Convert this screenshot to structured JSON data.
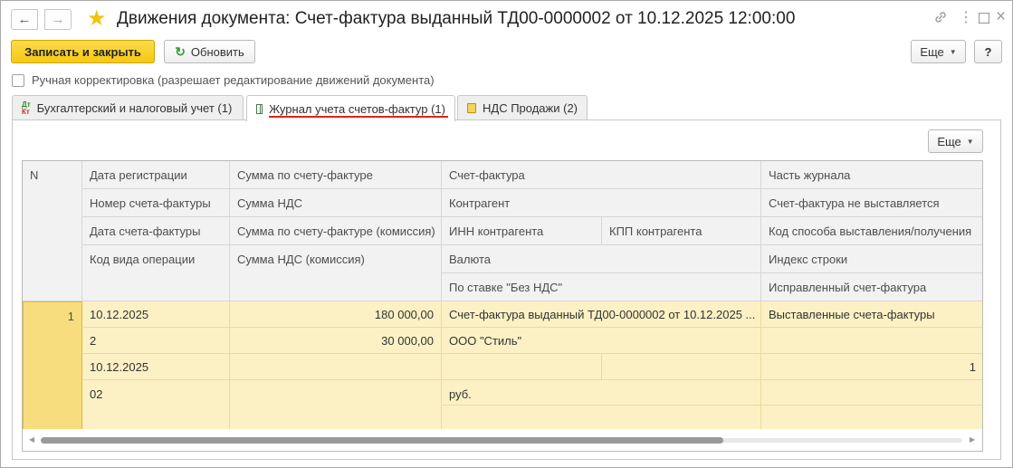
{
  "window": {
    "title": "Движения документа: Счет-фактура выданный ТД00-0000002 от 10.12.2025 12:00:00"
  },
  "toolbar": {
    "save_close_label": "Записать и закрыть",
    "refresh_label": "Обновить",
    "more_label": "Еще",
    "help_label": "?"
  },
  "manual_correction": {
    "label": "Ручная корректировка (разрешает редактирование движений документа)",
    "checked": false
  },
  "tabs": [
    {
      "label": "Бухгалтерский и налоговый учет (1)",
      "icon": "dt-kt-icon",
      "active": false
    },
    {
      "label": "Журнал учета счетов-фактур (1)",
      "icon": "table-grid-icon",
      "active": true
    },
    {
      "label": "НДС Продажи (2)",
      "icon": "vat-sales-icon",
      "active": false
    }
  ],
  "dtkt": {
    "top": "Дт",
    "bottom": "Кт"
  },
  "table_more_label": "Еще",
  "table": {
    "headers": {
      "n": "N",
      "r1": [
        "Дата регистрации",
        "Сумма по счету-фактуре",
        "Счет-фактура",
        "Часть журнала"
      ],
      "r2": [
        "Номер счета-фактуры",
        "Сумма НДС",
        "Контрагент",
        "Счет-фактура не выставляется"
      ],
      "r3": [
        "Дата счета-фактуры",
        "Сумма по счету-фактуре (комиссия)",
        "ИНН контрагента",
        "КПП контрагента",
        "Код способа выставления/получения"
      ],
      "r4": [
        "Код вида операции",
        "Сумма НДС (комиссия)",
        "Валюта",
        "Индекс строки"
      ],
      "r5": [
        "По ставке \"Без НДС\"",
        "Исправленный счет-фактура"
      ]
    },
    "row": {
      "n": "1",
      "registration_date": "10.12.2025",
      "invoice_amount": "180 000,00",
      "invoice": "Счет-фактура выданный ТД00-0000002 от 10.12.2025 ...",
      "journal_part": "Выставленные счета-фактуры",
      "invoice_number": "2",
      "vat_amount": "30 000,00",
      "counterparty": "ООО \"Стиль\"",
      "invoice_date": "10.12.2025",
      "row_index": "1",
      "operation_code": "02",
      "currency": "руб."
    }
  },
  "colors": {
    "accent_yellow": "#f5c812",
    "selected_row": "#fcf1c4",
    "active_tab_underline": "#d9261c"
  }
}
